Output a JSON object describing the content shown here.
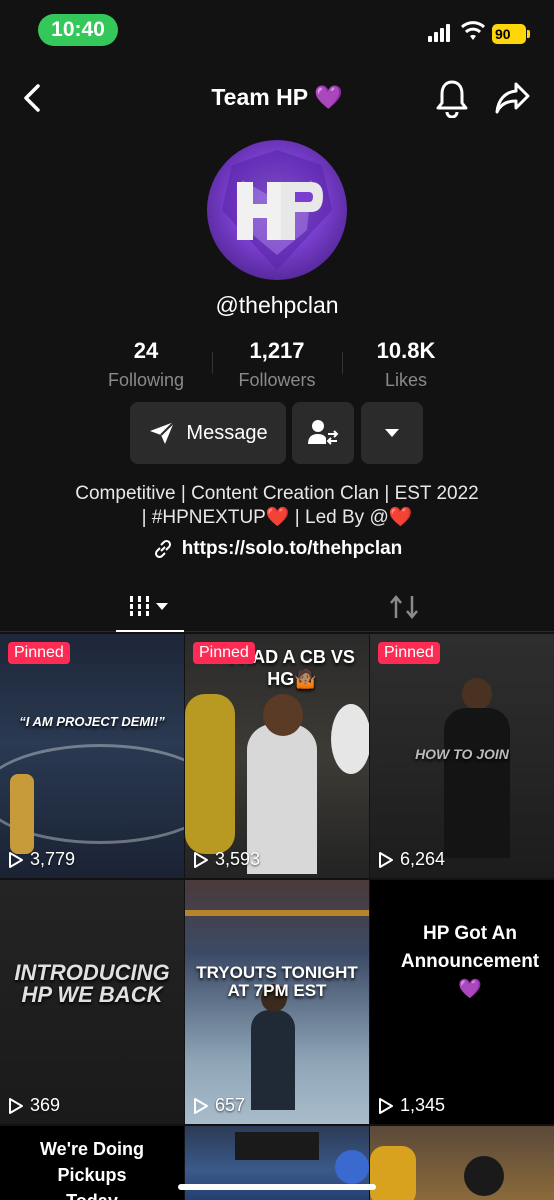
{
  "status_bar": {
    "time": "10:40",
    "battery": "90"
  },
  "nav": {
    "title": "Team HP",
    "title_emoji": "💜"
  },
  "profile": {
    "handle": "@thehpclan"
  },
  "stats": [
    {
      "value": "24",
      "label": "Following"
    },
    {
      "value": "1,217",
      "label": "Followers"
    },
    {
      "value": "10.8K",
      "label": "Likes"
    }
  ],
  "actions": {
    "message_label": "Message"
  },
  "bio": {
    "line1": "Competitive | Content Creation Clan | EST 2022",
    "line2_a": "| #HPNEXTUP",
    "line2_b": " | Led By @",
    "heart": "❤️",
    "link": "https://solo.to/thehpclan"
  },
  "videos": [
    {
      "pinned": "Pinned",
      "views": "3,779",
      "caption": "“I AM PROJECT DEMI!”"
    },
    {
      "pinned": "Pinned",
      "views": "3,593",
      "caption": "I HAD A CB VS HG🤷🏽"
    },
    {
      "pinned": "Pinned",
      "views": "6,264",
      "caption": "HOW TO JOIN"
    },
    {
      "views": "369",
      "caption": "INTRODUCING HP WE BACK"
    },
    {
      "views": "657",
      "caption": "TRYOUTS TONIGHT AT 7PM EST"
    },
    {
      "views": "1,345",
      "caption": "HP Got An Announcement💜"
    },
    {
      "caption": "We're Doing Pickups Today"
    }
  ],
  "colors": {
    "pinned": "#fe2c55",
    "accent": "#a26bf0",
    "status_green": "#34c759"
  }
}
